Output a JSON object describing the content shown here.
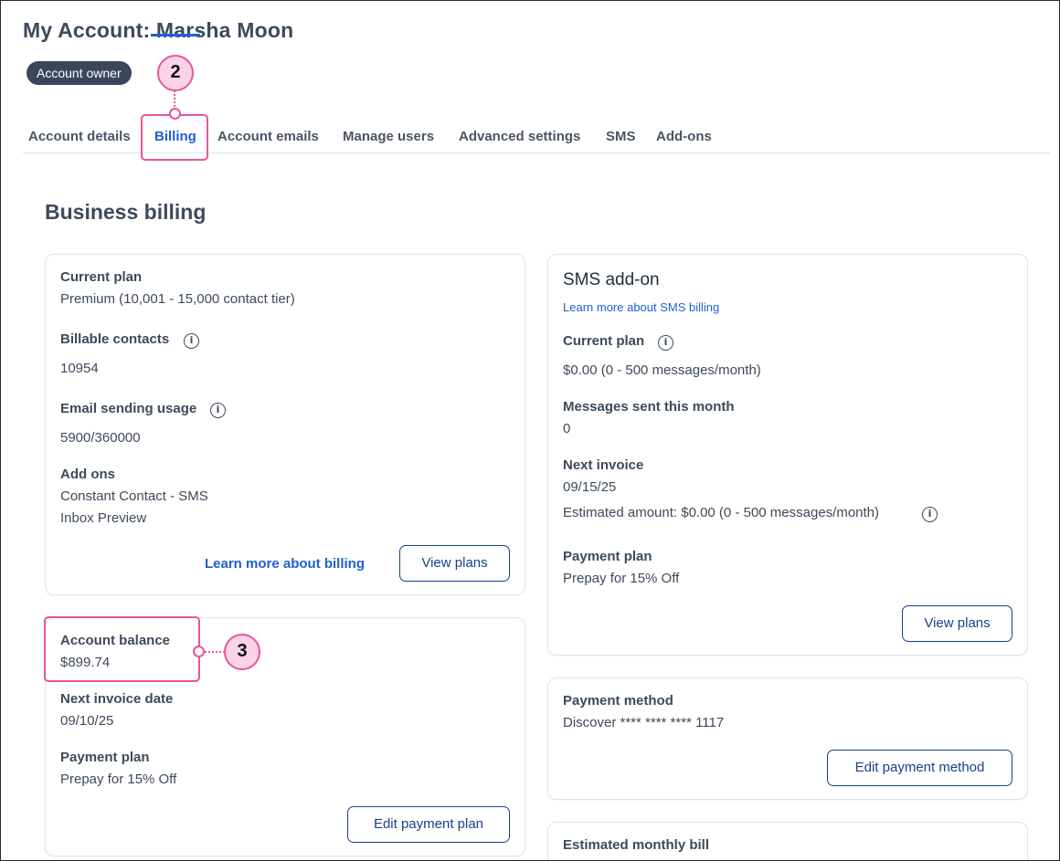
{
  "header": {
    "title": "My Account: Marsha Moon",
    "badge": "Account owner"
  },
  "tabs": [
    {
      "label": "Account details",
      "active": false
    },
    {
      "label": "Billing",
      "active": true
    },
    {
      "label": "Account emails",
      "active": false
    },
    {
      "label": "Manage users",
      "active": false
    },
    {
      "label": "Advanced settings",
      "active": false
    },
    {
      "label": "SMS",
      "active": false
    },
    {
      "label": "Add-ons",
      "active": false
    }
  ],
  "section_title": "Business billing",
  "plan_card": {
    "current_plan_label": "Current plan",
    "current_plan_value": "Premium (10,001 - 15,000 contact tier)",
    "billable_contacts_label": "Billable contacts",
    "billable_contacts_value": "10954",
    "email_usage_label": "Email sending usage",
    "email_usage_value": "5900/360000",
    "addons_label": "Add ons",
    "addons": [
      "Constant Contact - SMS",
      "Inbox Preview"
    ],
    "learn_more_link": "Learn more about billing",
    "view_plans_button": "View plans"
  },
  "balance_card": {
    "account_balance_label": "Account balance",
    "account_balance_value": "$899.74",
    "next_invoice_label": "Next invoice date",
    "next_invoice_value": "09/10/25",
    "payment_plan_label": "Payment plan",
    "payment_plan_value": "Prepay for 15% Off",
    "edit_button": "Edit payment plan"
  },
  "sms_card": {
    "title": "SMS add-on",
    "learn_more_link": "Learn more about SMS billing",
    "current_plan_label": "Current plan",
    "current_plan_value": "$0.00 (0 - 500 messages/month)",
    "messages_label": "Messages sent this month",
    "messages_value": "0",
    "next_invoice_label": "Next invoice",
    "next_invoice_date": "09/15/25",
    "estimated_amount": "Estimated amount: $0.00 (0 - 500 messages/month)",
    "payment_plan_label": "Payment plan",
    "payment_plan_value": "Prepay for 15% Off",
    "view_plans_button": "View plans"
  },
  "payment_method_card": {
    "label": "Payment method",
    "value": "Discover **** **** **** 1117",
    "edit_button": "Edit payment method"
  },
  "estimated_bill_card": {
    "label": "Estimated monthly bill"
  },
  "callouts": {
    "tab_marker": "2",
    "balance_marker": "3"
  },
  "icons": {
    "info": "info-icon"
  },
  "colors": {
    "accent": "#1f5fd4",
    "badge_bg": "#3a465b",
    "button_border": "#1a3f8a",
    "callout_pink": "#e8559a",
    "callout_fill": "#fbd3e6"
  }
}
